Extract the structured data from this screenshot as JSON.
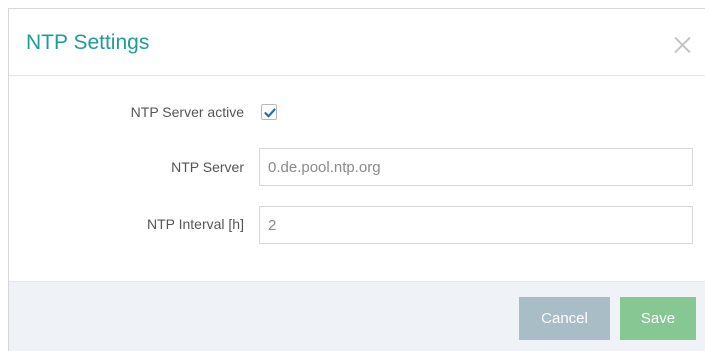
{
  "dialog": {
    "title": "NTP Settings",
    "close_icon": "close-icon"
  },
  "form": {
    "ntp_active_label": "NTP Server active",
    "ntp_active_checked": true,
    "ntp_server_label": "NTP Server",
    "ntp_server_value": "0.de.pool.ntp.org",
    "ntp_interval_label": "NTP Interval [h]",
    "ntp_interval_value": "2"
  },
  "footer": {
    "cancel_label": "Cancel",
    "save_label": "Save"
  },
  "colors": {
    "title": "#1f9b98",
    "checkmark": "#1f6fb2",
    "cancel_button": "#a9bdc7",
    "save_button": "#86c794",
    "footer_bg": "#eff3f8"
  }
}
